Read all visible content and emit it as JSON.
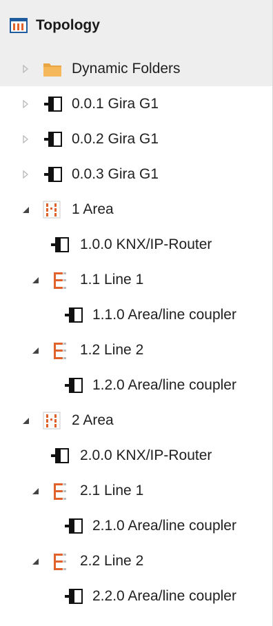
{
  "panel": {
    "title": "Topology"
  },
  "tree": {
    "dynamic_folders": "Dynamic Folders",
    "device_001": "0.0.1 Gira G1",
    "device_002": "0.0.2 Gira G1",
    "device_003": "0.0.3 Gira G1",
    "area1": {
      "label": "1 Area",
      "router": "1.0.0 KNX/IP-Router",
      "line1": {
        "label": "1.1 Line 1",
        "coupler": "1.1.0 Area/line coupler"
      },
      "line2": {
        "label": "1.2 Line 2",
        "coupler": "1.2.0 Area/line coupler"
      }
    },
    "area2": {
      "label": "2 Area",
      "router": "2.0.0 KNX/IP-Router",
      "line1": {
        "label": "2.1 Line 1",
        "coupler": "2.1.0 Area/line coupler"
      },
      "line2": {
        "label": "2.2 Line 2",
        "coupler": "2.2.0 Area/line coupler"
      }
    }
  },
  "colors": {
    "accent_orange": "#e0622a",
    "folder_yellow": "#f0b552",
    "header_bg": "#eeeeee",
    "expander_gray": "#9a9a9a",
    "expander_dark": "#444444"
  },
  "icons": {
    "header": "topology-icon",
    "folder": "folder-icon",
    "device": "device-icon",
    "area": "area-icon",
    "line": "line-icon"
  }
}
